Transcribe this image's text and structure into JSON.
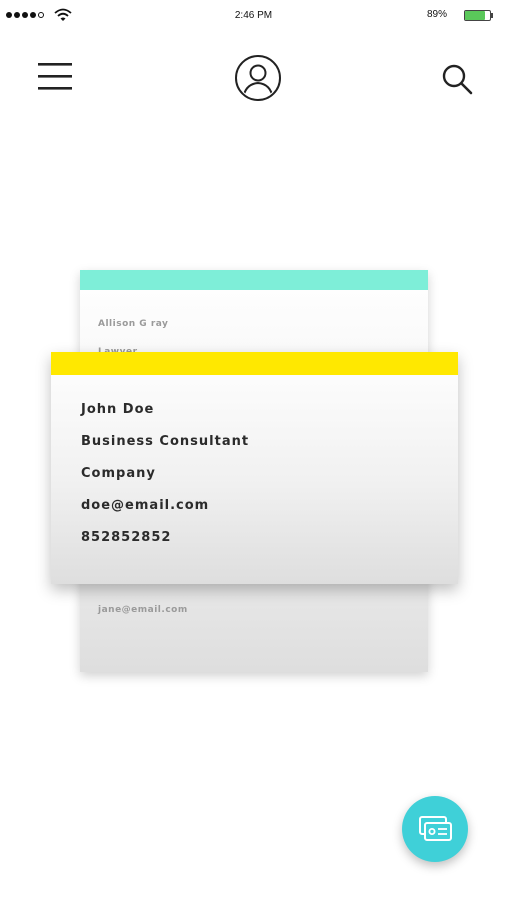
{
  "status_bar": {
    "time": "2:46 PM",
    "battery_percent": "89%",
    "battery_level": 0.89,
    "signal_bars_filled": 4,
    "signal_bars_total": 5,
    "icons": [
      "signal-dots",
      "wifi",
      "battery"
    ]
  },
  "nav": {
    "icons": [
      "hamburger-menu",
      "user-avatar",
      "search-magnifier"
    ]
  },
  "back_card": {
    "accent_color": "#7eeed8",
    "name": "Allison G   ray",
    "partial_line": "Lawyer",
    "email": "jane@email.com"
  },
  "front_card": {
    "accent_color": "#ffe800",
    "name": "John Doe",
    "title": "Business Consultant",
    "company": "Company",
    "email": "doe@email.com",
    "phone": "852852852"
  },
  "fab": {
    "icon": "business-cards",
    "color": "#3fd0d8"
  }
}
